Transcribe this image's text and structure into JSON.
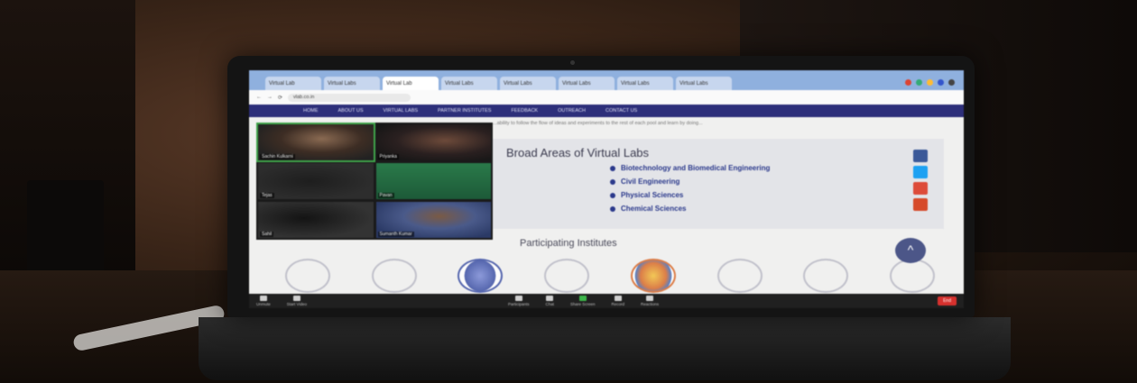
{
  "browser": {
    "tabs": [
      "Virtual Lab",
      "Virtual Labs",
      "Virtual Lab",
      "Virtual Labs",
      "Virtual Labs",
      "Virtual Labs",
      "Virtual Labs",
      "Virtual Labs"
    ],
    "url": "vlab.co.in"
  },
  "site": {
    "nav": [
      "HOME",
      "ABOUT US",
      "VIRTUAL LABS",
      "PARTNER INSTITUTES",
      "FEEDBACK",
      "OUTREACH",
      "CONTACT US"
    ],
    "intro_text": "...ability to follow the flow of ideas and experiments to the rest of each pool and learn by doing...",
    "areas_title": "Broad Areas of Virtual Labs",
    "areas": [
      "Biotechnology and Biomedical Engineering",
      "Civil Engineering",
      "Physical Sciences",
      "Chemical Sciences"
    ],
    "participating_title": "Participating Institutes",
    "up_symbol": "^"
  },
  "zoom": {
    "participants": [
      {
        "name": "Sachin Kulkarni"
      },
      {
        "name": "Priyanka"
      },
      {
        "name": "Tejas"
      },
      {
        "name": "Pavan"
      },
      {
        "name": "Sahil"
      },
      {
        "name": "Sumanth Kumar"
      }
    ],
    "toolbar": {
      "left": [
        "Unmute",
        "Start Video"
      ],
      "center": [
        "Participants",
        "Chat",
        "Share Screen",
        "Record",
        "Reactions"
      ],
      "end": "End"
    }
  },
  "colors": {
    "site_nav": "#2d2f7a",
    "accent_link": "#2c3a8c",
    "end_button": "#d6312e",
    "share_screen": "#3cb64a"
  }
}
